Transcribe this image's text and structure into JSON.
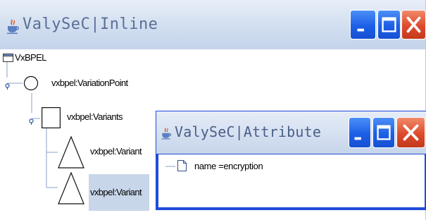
{
  "main_window": {
    "title": "ValySeC|Inline",
    "controls": {
      "minimize_icon": "minimize-icon",
      "maximize_icon": "maximize-icon",
      "close_icon": "close-icon"
    },
    "tree": {
      "root": {
        "label": "VxBPEL",
        "icon": "folder-icon"
      },
      "variation_point": {
        "label": "vxbpel:VariationPoint",
        "icon": "circle-icon"
      },
      "variants": {
        "label": "vxbpel:Variants",
        "icon": "square-icon"
      },
      "variant_items": [
        {
          "label": "vxbpel:Variant",
          "icon": "triangle-icon",
          "selected": false
        },
        {
          "label": "vxbpel:Variant",
          "icon": "triangle-icon",
          "selected": true
        }
      ]
    }
  },
  "attribute_window": {
    "title": "ValySeC|Attribute",
    "attributes": [
      {
        "label": "name =encryption",
        "icon": "file-icon"
      }
    ]
  },
  "colors": {
    "titlebar": "#d5e1f1",
    "title_text": "#5b6f96",
    "button_blue": "#1d5fe6",
    "button_red": "#dc4c2c",
    "selection": "#c8d6ea",
    "dialog_border": "#1e4bd8"
  }
}
